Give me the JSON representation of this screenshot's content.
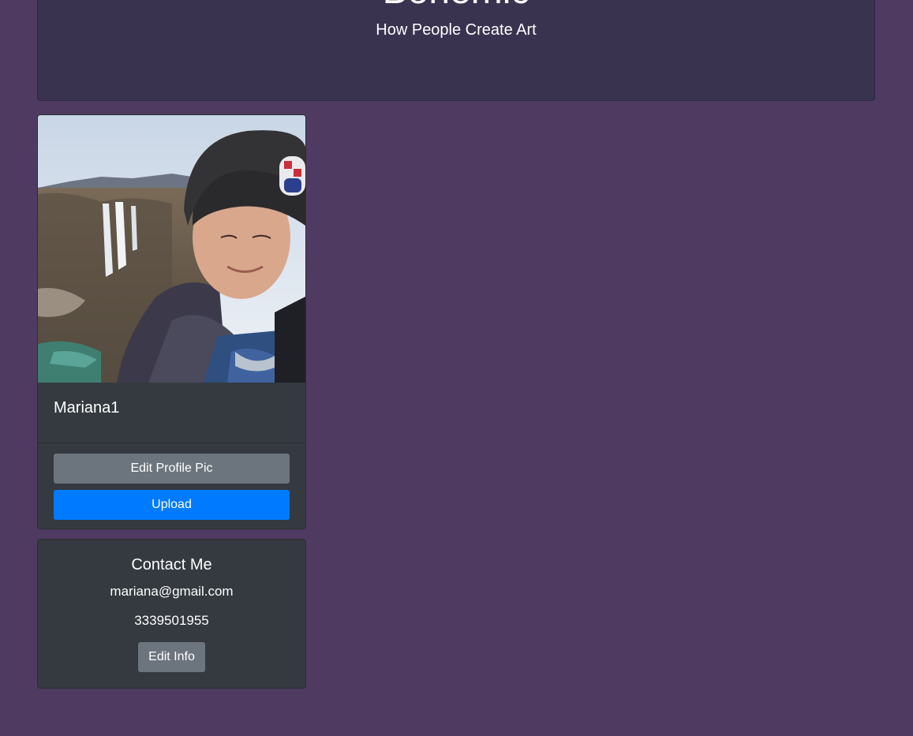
{
  "header": {
    "title": "Bohemic",
    "tagline": "How People Create Art"
  },
  "profile": {
    "photo_alt": "Profile photo",
    "username": "Mariana1",
    "edit_pic_label": "Edit Profile Pic",
    "upload_label": "Upload"
  },
  "contact": {
    "title": "Contact Me",
    "email": "mariana@gmail.com",
    "phone": "3339501955",
    "edit_label": "Edit Info"
  },
  "colors": {
    "background": "#4f3b61",
    "header_bg": "#3a3350",
    "card_bg": "#343a40",
    "secondary_button": "#6c757d",
    "primary_button": "#007bff"
  }
}
